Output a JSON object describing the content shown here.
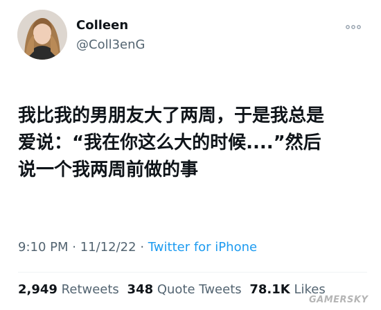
{
  "author": {
    "display_name": "Colleen",
    "handle": "@Coll3enG",
    "avatar_icon": "profile-photo"
  },
  "more_icon": "ellipsis-icon",
  "tweet": {
    "lines": [
      "我比我的男朋友大了两周，于是我总是",
      "爱说：“我在你这么大的时候....”然后",
      "说一个我两周前做的事"
    ]
  },
  "meta": {
    "time": "9:10 PM",
    "date": "11/12/22",
    "separator": "·",
    "source": "Twitter for iPhone"
  },
  "stats": {
    "retweets_count": "2,949",
    "retweets_label": "Retweets",
    "quotes_count": "348",
    "quotes_label": "Quote Tweets",
    "likes_count": "78.1K",
    "likes_label": "Likes"
  },
  "watermark": "GAMERSKY",
  "colors": {
    "text": "#0f1419",
    "secondary": "#536471",
    "link": "#1d9bf0"
  }
}
